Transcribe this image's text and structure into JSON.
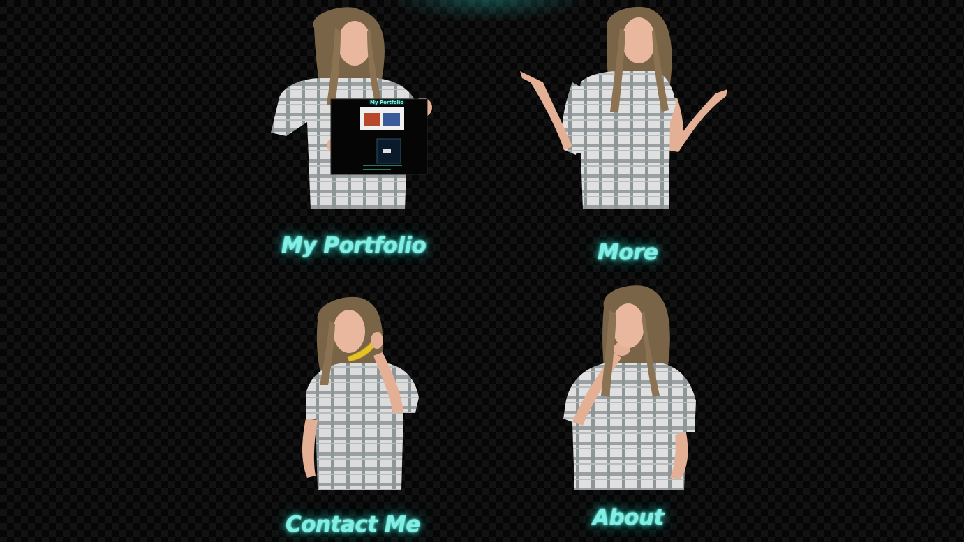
{
  "tiles": [
    {
      "id": "portfolio",
      "label": "My Portfolio",
      "inner_sign": "My Portfolio"
    },
    {
      "id": "more",
      "label": "More"
    },
    {
      "id": "contact",
      "label": "Contact Me"
    },
    {
      "id": "about",
      "label": "About"
    }
  ],
  "colors": {
    "accent": "#7ff0e6",
    "glow": "#28d2c3",
    "background": "#060606",
    "checker": "#121212"
  }
}
